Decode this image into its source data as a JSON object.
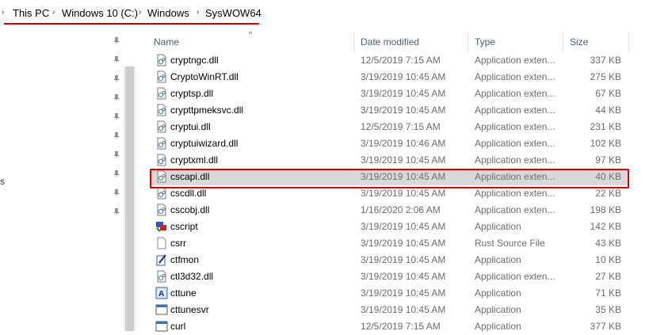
{
  "breadcrumb": {
    "items": [
      "This PC",
      "Windows 10 (C:)",
      "Windows",
      "SysWOW64"
    ]
  },
  "nav": {
    "partial_label": "s"
  },
  "columns": {
    "name": "Name",
    "date": "Date modified",
    "type": "Type",
    "size": "Size"
  },
  "files": [
    {
      "name": "cryptngc.dll",
      "date": "12/5/2019 7:15 AM",
      "type": "Application exten...",
      "size": "337 KB",
      "icon": "dll-icon"
    },
    {
      "name": "CryptoWinRT.dll",
      "date": "3/19/2019 10:45 AM",
      "type": "Application exten...",
      "size": "275 KB",
      "icon": "dll-icon"
    },
    {
      "name": "cryptsp.dll",
      "date": "3/19/2019 10:45 AM",
      "type": "Application exten...",
      "size": "67 KB",
      "icon": "dll-icon"
    },
    {
      "name": "crypttpmeksvc.dll",
      "date": "3/19/2019 10:45 AM",
      "type": "Application exten...",
      "size": "44 KB",
      "icon": "dll-icon"
    },
    {
      "name": "cryptui.dll",
      "date": "12/5/2019 7:15 AM",
      "type": "Application exten...",
      "size": "231 KB",
      "icon": "dll-icon"
    },
    {
      "name": "cryptuiwizard.dll",
      "date": "3/19/2019 10:46 AM",
      "type": "Application exten...",
      "size": "102 KB",
      "icon": "dll-icon"
    },
    {
      "name": "cryptxml.dll",
      "date": "3/19/2019 10:45 AM",
      "type": "Application exten...",
      "size": "97 KB",
      "icon": "dll-icon"
    },
    {
      "name": "cscapi.dll",
      "date": "3/19/2019 10:45 AM",
      "type": "Application exten...",
      "size": "40 KB",
      "icon": "dll-icon",
      "selected": true
    },
    {
      "name": "cscdll.dll",
      "date": "3/19/2019 10:45 AM",
      "type": "Application exten...",
      "size": "22 KB",
      "icon": "dll-icon"
    },
    {
      "name": "cscobj.dll",
      "date": "1/16/2020 2:06 AM",
      "type": "Application exten...",
      "size": "198 KB",
      "icon": "dll-icon"
    },
    {
      "name": "cscript",
      "date": "3/19/2019 10:45 AM",
      "type": "Application",
      "size": "142 KB",
      "icon": "script-app-icon"
    },
    {
      "name": "csrr",
      "date": "3/19/2019 10:45 AM",
      "type": "Rust Source File",
      "size": "43 KB",
      "icon": "blank-file-icon"
    },
    {
      "name": "ctfmon",
      "date": "3/19/2019 10:45 AM",
      "type": "Application",
      "size": "10 KB",
      "icon": "pen-app-icon"
    },
    {
      "name": "ctl3d32.dll",
      "date": "3/19/2019 10:45 AM",
      "type": "Application exten...",
      "size": "27 KB",
      "icon": "dll-icon"
    },
    {
      "name": "cttune",
      "date": "3/19/2019 10:45 AM",
      "type": "Application",
      "size": "71 KB",
      "icon": "font-app-icon"
    },
    {
      "name": "cttunesvr",
      "date": "3/19/2019 10:45 AM",
      "type": "Application",
      "size": "35 KB",
      "icon": "window-app-icon"
    },
    {
      "name": "curl",
      "date": "12/5/2019 7:15 AM",
      "type": "Application",
      "size": "377 KB",
      "icon": "window-app-icon"
    }
  ],
  "colors": {
    "selection_outline": "#d40000",
    "selected_row": "#d9d9d9",
    "header_text": "#4c607a"
  }
}
